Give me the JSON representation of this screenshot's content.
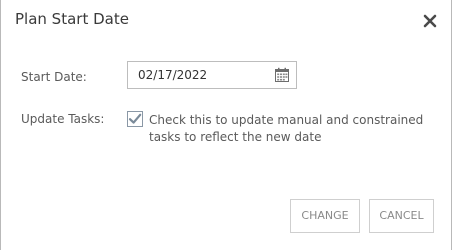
{
  "dialog": {
    "title": "Plan Start Date",
    "close_icon": "close-icon"
  },
  "form": {
    "start_date_label": "Start Date:",
    "start_date_value": "02/17/2022",
    "calendar_icon": "calendar-icon",
    "update_tasks_label": "Update Tasks:",
    "update_tasks_checked": true,
    "update_tasks_text": "Check this to update manual and constrained tasks to reflect the new date"
  },
  "buttons": {
    "change_label": "CHANGE",
    "cancel_label": "CANCEL"
  },
  "colors": {
    "accent_checkbox": "#7a8a99",
    "button_text": "#8a8a8a",
    "border": "#bdbdbd"
  }
}
